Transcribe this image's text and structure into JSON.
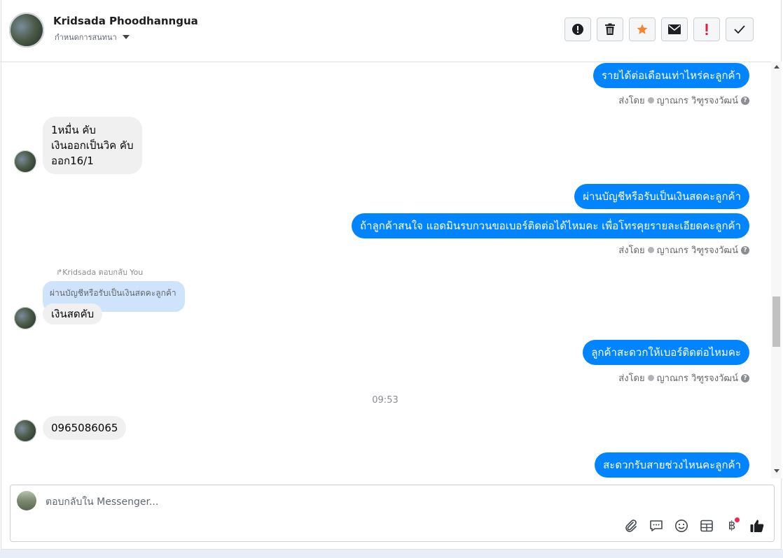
{
  "header": {
    "name": "Kridsada Phoodhanngua",
    "assign_label": "กำหนดการสนทนา",
    "tools": [
      {
        "icon": "alert-circle-icon",
        "label": "Mark as spam"
      },
      {
        "icon": "trash-icon",
        "label": "Delete"
      },
      {
        "icon": "star-icon",
        "label": "Follow up"
      },
      {
        "icon": "envelope-icon",
        "label": "Mark as unread"
      },
      {
        "icon": "exclamation-icon",
        "label": "Priority"
      },
      {
        "icon": "checkmark-icon",
        "label": "Done"
      }
    ]
  },
  "messages": {
    "m1": "รายได้ต่อเดือนเท่าไหร่คะลูกค้า",
    "sent_by_prefix": "ส่งโดย",
    "sent_by_name": "ญาณกร วิฑูรจงวัฒน์",
    "help_glyph": "?",
    "in1_line1": "1หมื่น คับ",
    "in1_line2": "เงินออกเป็นวิค คับ",
    "in1_line3": "ออก16/1",
    "m2": "ผ่านบัญชีหรือรับเป็นเงินสดคะลูกค้า",
    "m3": "ถ้าลูกค้าสนใจ แอดมินรบกวนขอเบอร์ติดต่อได้ไหมคะ เพื่อโทรคุยรายละเอียดคะลูกค้า",
    "reply_label": "↱Kridsada ตอบกลับ You",
    "quoted": "ผ่านบัญชีหรือรับเป็นเงินสดคะลูกค้า",
    "in2": "เงินสดคับ",
    "m4": "ลูกค้าสะดวกให้เบอร์ติดต่อไหมคะ",
    "time": "09:53",
    "in3": "0965086065",
    "m5": "สะดวกรับสายช่วงไหนคะลูกค้า"
  },
  "composer": {
    "placeholder": "ตอบกลับใน Messenger...",
    "icons": [
      "paperclip-icon",
      "chat-bubble-icon",
      "emoji-icon",
      "table-icon",
      "baht-icon",
      "thumbs-up-icon"
    ],
    "baht_glyph": "฿"
  },
  "colors": {
    "accent": "#0084ff",
    "star": "#f5852c",
    "alert": "#e41e3f"
  }
}
